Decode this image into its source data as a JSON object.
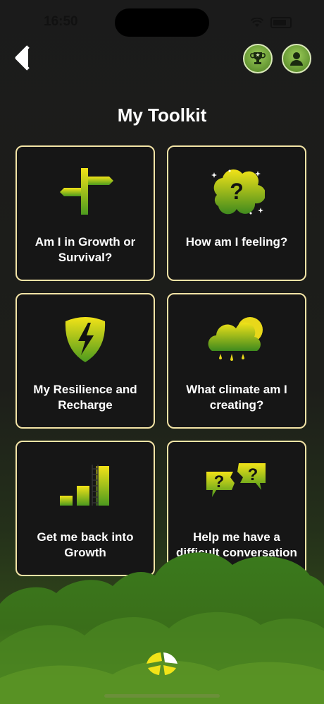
{
  "status": {
    "time": "16:50"
  },
  "header": {
    "title": "My Toolkit"
  },
  "cards": [
    {
      "label": "Am I in Growth or Survival?",
      "icon": "signpost-icon"
    },
    {
      "label": "How am I feeling?",
      "icon": "question-brain-icon"
    },
    {
      "label": "My Resilience and Recharge",
      "icon": "shield-bolt-icon"
    },
    {
      "label": "What climate am I creating?",
      "icon": "cloud-sun-icon"
    },
    {
      "label": "Get me back into Growth",
      "icon": "bar-ladder-icon"
    },
    {
      "label": "Help me have a difficult conversation",
      "icon": "speech-question-icon"
    }
  ],
  "colors": {
    "accent": "#c9dc1f",
    "green": "#3f7a1e",
    "card_border": "#f3e4a6"
  }
}
